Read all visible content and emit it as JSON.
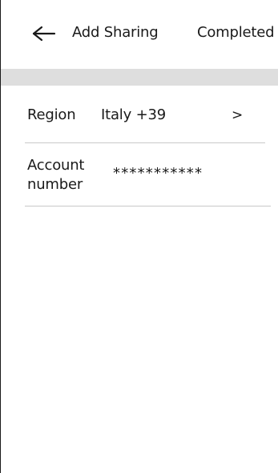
{
  "header": {
    "back_icon": "arrow-left-icon",
    "title": "Add Sharing",
    "action_label": "Completed"
  },
  "form": {
    "region": {
      "label": "Region",
      "value": "Italy +39",
      "chevron": ">"
    },
    "account": {
      "label": "Account number",
      "value": "***********"
    }
  },
  "colors": {
    "background": "#ffffff",
    "text": "#1a1a1a",
    "band": "#dedede",
    "divider": "#c8c8c8"
  }
}
